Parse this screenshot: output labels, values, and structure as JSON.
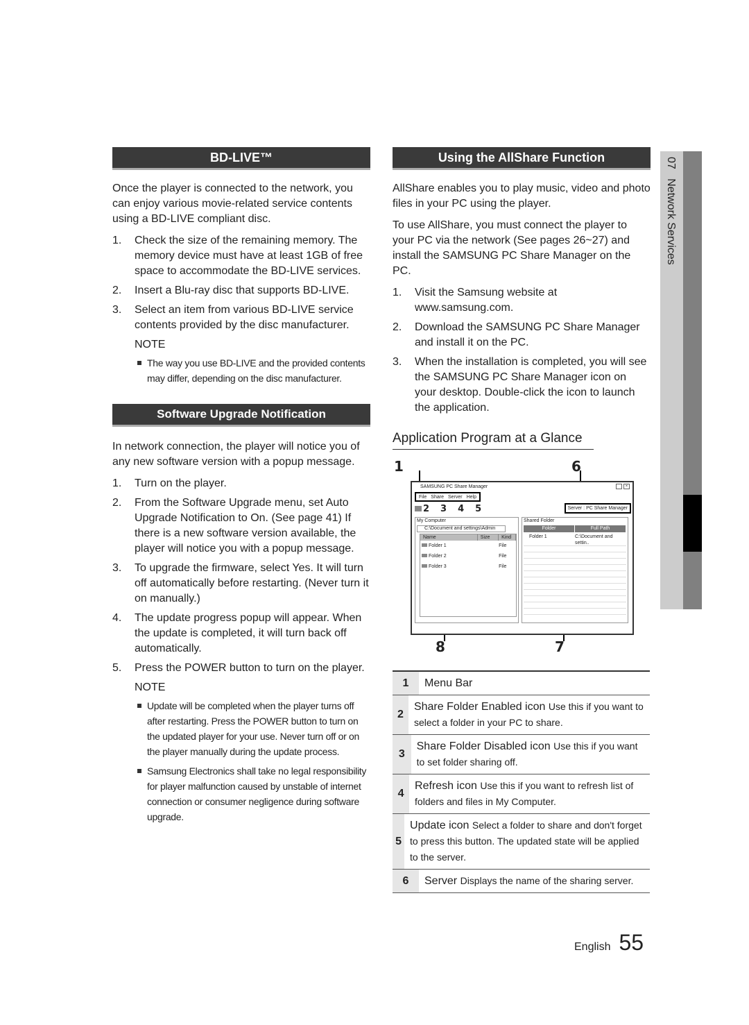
{
  "bdlive": {
    "title": "BD-LIVE™",
    "intro": "Once the player is connected to the network, you can enjoy various movie-related service contents using a BD-LIVE compliant disc.",
    "steps": [
      {
        "n": "1.",
        "t": "Check the size of the remaining memory. The memory device must have at least 1GB of free space to accommodate the BD-LIVE services."
      },
      {
        "n": "2.",
        "t": "Insert a Blu-ray disc that supports BD-LIVE."
      },
      {
        "n": "3.",
        "t": "Select an item from various BD-LIVE service contents provided by the disc manufacturer."
      }
    ],
    "note_label": "NOTE",
    "notes": [
      "The way you use BD-LIVE and the provided contents may differ, depending on the disc manufacturer."
    ]
  },
  "upgrade": {
    "title": "Software Upgrade Notification",
    "intro": "In network connection, the player will notice you of any new software version with a popup message.",
    "steps": [
      {
        "n": "1.",
        "t": "Turn on the player."
      },
      {
        "n": "2.",
        "t": "From the Software Upgrade menu, set Auto Upgrade Notification to On. (See page 41) If there is a new software version available, the player will notice you with a popup message."
      },
      {
        "n": "3.",
        "t": "To upgrade the firmware, select Yes. It will turn off automatically before restarting. (Never turn it on manually.)"
      },
      {
        "n": "4.",
        "t": "The update progress popup will appear. When the update is completed, it will turn back off automatically."
      },
      {
        "n": "5.",
        "t": "Press the POWER button to turn on the player."
      }
    ],
    "note_label": "NOTE",
    "notes": [
      "Update will be completed when the player turns off after restarting. Press the POWER button to turn on the updated player for your use. Never turn off or on the player manually during the update process.",
      "Samsung Electronics shall take no legal responsibility for player malfunction caused by unstable of internet connection or consumer negligence during software upgrade."
    ]
  },
  "allshare": {
    "title": "Using the AllShare Function",
    "intro1": "AllShare enables you to play music, video and photo files in your PC using the player.",
    "intro2": "To use AllShare, you must connect the player to your PC via the network (See pages 26~27) and install the SAMSUNG PC Share Manager on the PC.",
    "steps": [
      {
        "n": "1.",
        "t": "Visit the Samsung website at www.samsung.com."
      },
      {
        "n": "2.",
        "t": "Download the SAMSUNG PC Share Manager and install it on the PC."
      },
      {
        "n": "3.",
        "t": "When the installation is completed, you will see the SAMSUNG PC Share Manager icon on your desktop. Double-click the icon to launch the application."
      }
    ],
    "glance_title": "Application Program at a Glance"
  },
  "app": {
    "title": "SAMSUNG PC Share Manager",
    "menu": [
      "File",
      "Share",
      "Server",
      "Help"
    ],
    "server": "Server : PC Share Manager",
    "my_computer": "My Computer",
    "path": "C:\\Document and settings\\Admin",
    "cols": [
      "Name",
      "Size",
      "Kind"
    ],
    "files": [
      {
        "name": "Folder 1",
        "kind": "File"
      },
      {
        "name": "Folder 2",
        "kind": "File"
      },
      {
        "name": "Folder 3",
        "kind": "File"
      }
    ],
    "shared": "Shared Folder",
    "shared_cols": [
      "Folder",
      "Full Path"
    ],
    "shared_rows": [
      {
        "folder": "Folder 1",
        "path": "C:\\Document and settin.."
      }
    ],
    "callouts": [
      "1",
      "2",
      "3",
      "4",
      "5",
      "6",
      "7",
      "8"
    ]
  },
  "legend": [
    {
      "n": "1",
      "b": "Menu Bar",
      "t": ""
    },
    {
      "n": "2",
      "b": "Share Folder Enabled icon",
      "t": "Use this if you want to select a folder in your PC to share."
    },
    {
      "n": "3",
      "b": "Share Folder Disabled icon",
      "t": "Use this if you want to set folder sharing off."
    },
    {
      "n": "4",
      "b": "Refresh icon",
      "t": "Use this if you want to refresh list of folders and files in My Computer."
    },
    {
      "n": "5",
      "b": "Update icon",
      "t": "Select a folder to share and don't forget to press this button. The updated state will be applied to the server."
    },
    {
      "n": "6",
      "b": "Server",
      "t": "Displays the name of the sharing server."
    }
  ],
  "side_tab": {
    "chapter": "07",
    "title": "Network Services"
  },
  "footer": {
    "lang": "English",
    "page": "55"
  }
}
